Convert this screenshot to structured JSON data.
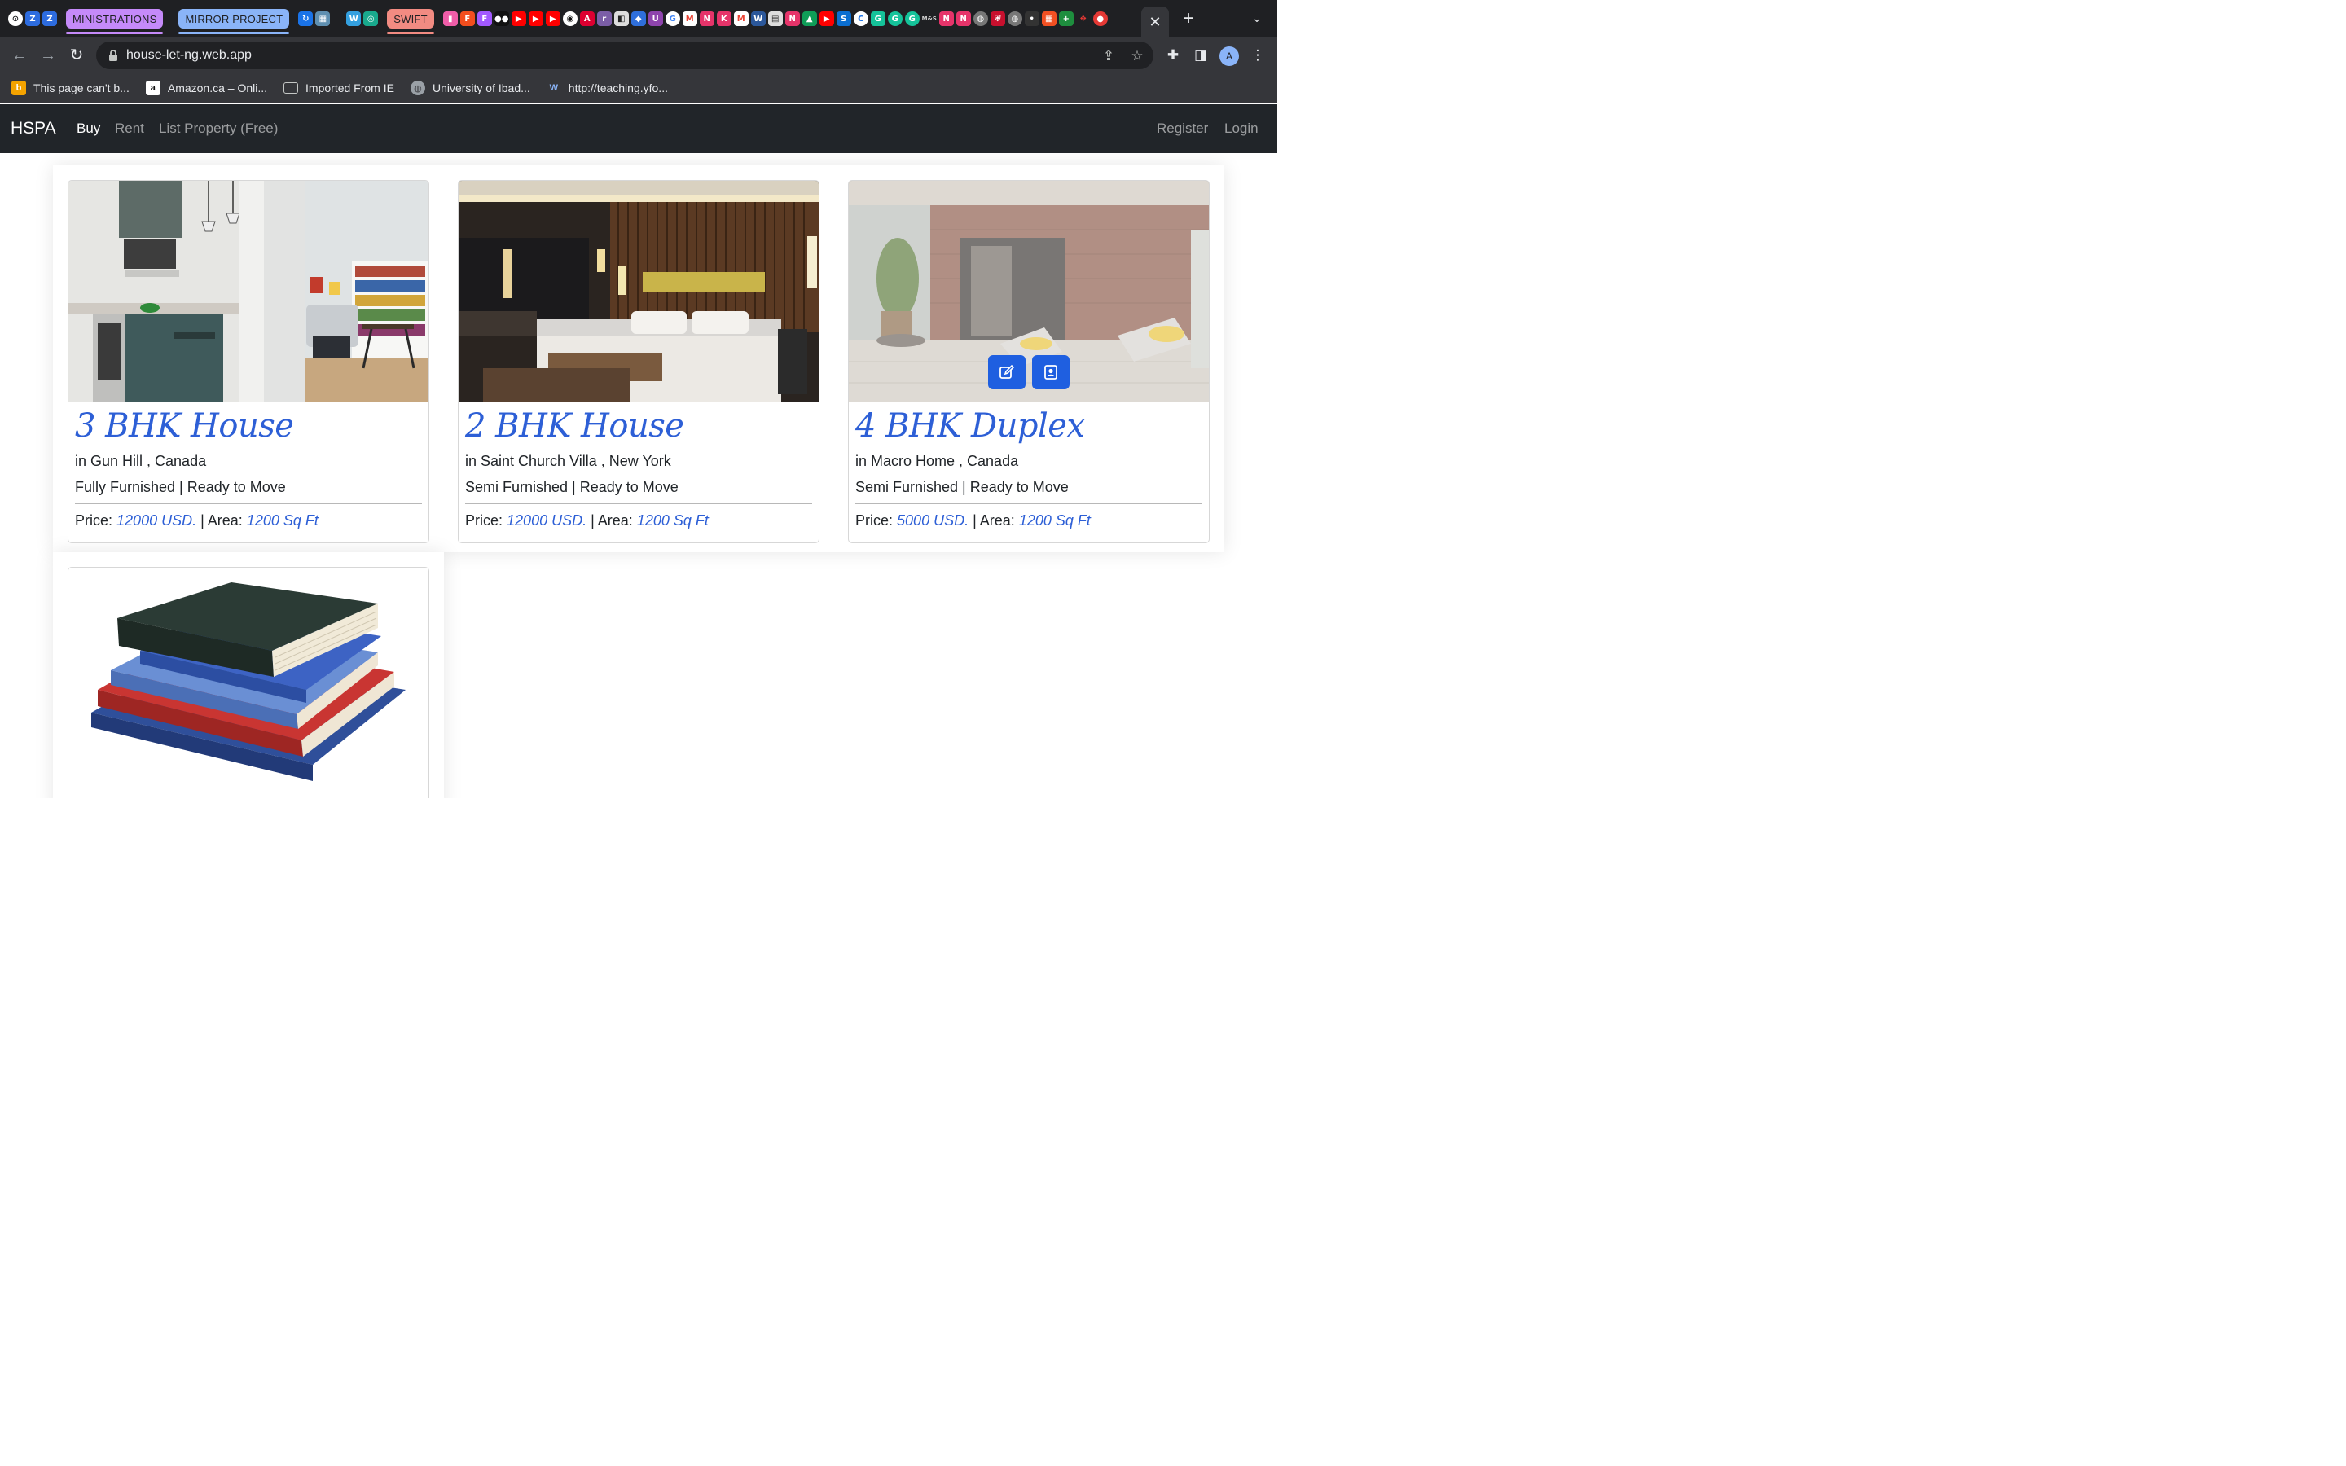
{
  "browser": {
    "tab_groups": [
      {
        "label": "MINISTRATIONS",
        "color": "#c58af9"
      },
      {
        "label": "MIRROR PROJECT",
        "color": "#8ab4f8"
      },
      {
        "label": "SWIFT",
        "color": "#f28b82"
      }
    ],
    "active_tab_close": "✕",
    "new_tab": "+",
    "url": "house-let-ng.web.app",
    "profile_initial": "A",
    "bookmarks": [
      {
        "label": "This page can't b...",
        "icon": "bing-icon"
      },
      {
        "label": "Amazon.ca – Onli...",
        "icon": "amazon-icon"
      },
      {
        "label": "Imported From IE",
        "icon": "folder-icon"
      },
      {
        "label": "University of Ibad...",
        "icon": "globe-icon"
      },
      {
        "label": "http://teaching.yfo...",
        "icon": "w-icon"
      }
    ]
  },
  "site": {
    "brand": "HSPA",
    "nav": {
      "buy": "Buy",
      "rent": "Rent",
      "list": "List Property (Free)",
      "register": "Register",
      "login": "Login"
    }
  },
  "labels": {
    "price": "Price:",
    "area": "Area:",
    "sep": " | "
  },
  "properties": [
    {
      "title": "3 BHK House",
      "location": "in Gun Hill , Canada",
      "features": "Fully Furnished | Ready to Move",
      "price": "12000 USD.",
      "area": "1200 Sq Ft"
    },
    {
      "title": "2 BHK House",
      "location": "in Saint Church Villa , New York",
      "features": "Semi Furnished | Ready to Move",
      "price": "12000 USD.",
      "area": "1200 Sq Ft"
    },
    {
      "title": "4 BHK Duplex",
      "location": "in Macro Home , Canada",
      "features": "Semi Furnished | Ready to Move",
      "price": "5000 USD.",
      "area": "1200 Sq Ft"
    }
  ],
  "colors": {
    "accent": "#2d5fd6",
    "navbar": "#212529",
    "action_button": "#1f5fe0"
  }
}
